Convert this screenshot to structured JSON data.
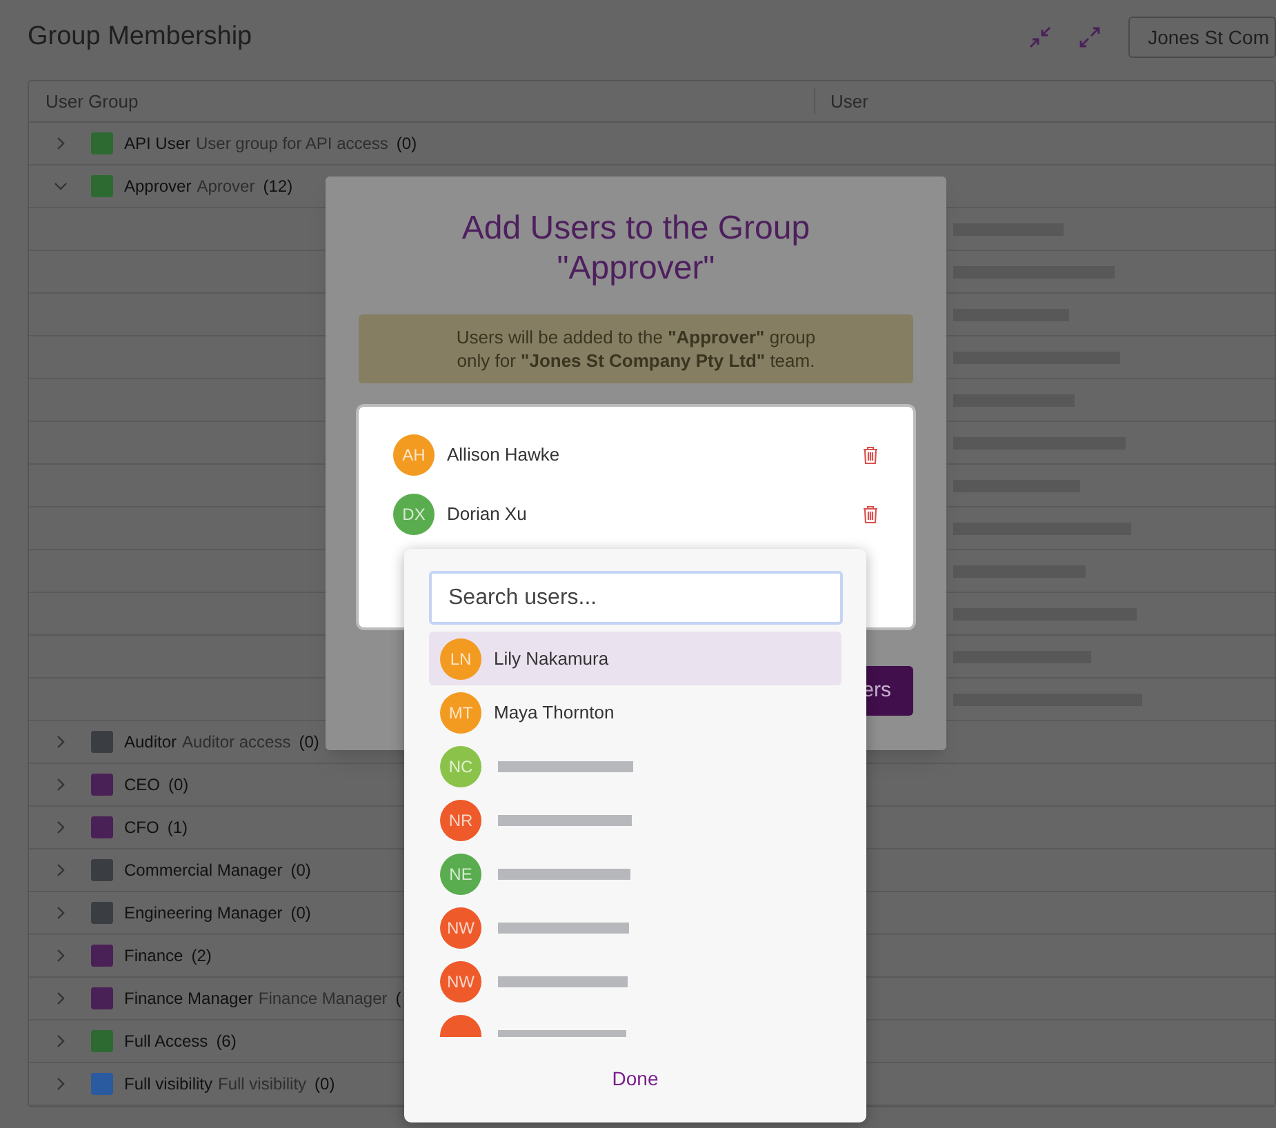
{
  "page": {
    "title": "Group Membership",
    "team_selector": "Jones St Com"
  },
  "table": {
    "columns": [
      "User Group",
      "User"
    ],
    "groups": [
      {
        "name": "API User",
        "description": "User group for API access",
        "count": "(0)",
        "color": "#2d6a32",
        "expanded": false
      },
      {
        "name": "Approver",
        "description": "Aprover",
        "count": "(12)",
        "color": "#2d6a32",
        "expanded": true
      },
      {
        "name": "Auditor",
        "description": "Auditor access",
        "count": "(0)",
        "color": "#3a3e42",
        "expanded": false
      },
      {
        "name": "CEO",
        "count": "(0)",
        "color": "#4a2157",
        "expanded": false
      },
      {
        "name": "CFO",
        "count": "(1)",
        "color": "#4a2157",
        "expanded": false
      },
      {
        "name": "Commercial Manager",
        "count": "(0)",
        "color": "#3a3e42",
        "expanded": false
      },
      {
        "name": "Engineering Manager",
        "count": "(0)",
        "color": "#3a3e42",
        "expanded": false
      },
      {
        "name": "Finance",
        "count": "(2)",
        "color": "#4a2157",
        "expanded": false
      },
      {
        "name": "Finance Manager",
        "description": "Finance Manager",
        "count": "(",
        "color": "#4a2157",
        "expanded": false
      },
      {
        "name": "Full Access",
        "count": "(6)",
        "color": "#2d6a32",
        "expanded": false
      },
      {
        "name": "Full visibility",
        "description": "Full visibility",
        "count": "(0)",
        "color": "#2a5aa0",
        "expanded": false
      }
    ]
  },
  "modal": {
    "title_lines": [
      "Add Users to the Group",
      "\"Approver\""
    ],
    "notice_lines": [
      "Users will be added to the **\"Approver\"** group",
      "only for **\"Jones St Company Pty Ltd\"** team."
    ],
    "selected_users": [
      {
        "initials": "AH",
        "name": "Allison Hawke",
        "color": "#f39a21"
      },
      {
        "initials": "DX",
        "name": "Dorian Xu",
        "color": "#5aad4e"
      }
    ],
    "submit_button": "ers"
  },
  "dropdown": {
    "search": {
      "placeholder": "Search users..."
    },
    "options": [
      {
        "kind": "named",
        "initials": "LN",
        "name": "Lily Nakamura",
        "color": "#f39a21",
        "selected": true
      },
      {
        "kind": "named",
        "initials": "MT",
        "name": "Maya Thornton",
        "color": "#f39a21",
        "selected": false
      },
      {
        "kind": "redacted",
        "initials": "NC",
        "color": "#8bc34a",
        "selected": false
      },
      {
        "kind": "redacted",
        "initials": "NR",
        "color": "#ee5a2a",
        "selected": false
      },
      {
        "kind": "redacted",
        "initials": "NE",
        "color": "#5aad4e",
        "selected": false
      },
      {
        "kind": "redacted",
        "initials": "NW",
        "color": "#ee5a2a",
        "selected": false
      },
      {
        "kind": "redacted",
        "initials": "NW",
        "color": "#ee5a2a",
        "selected": false
      },
      {
        "kind": "redacted",
        "color": "#ee5a2a",
        "selected": false
      }
    ],
    "done_button": "Done"
  }
}
